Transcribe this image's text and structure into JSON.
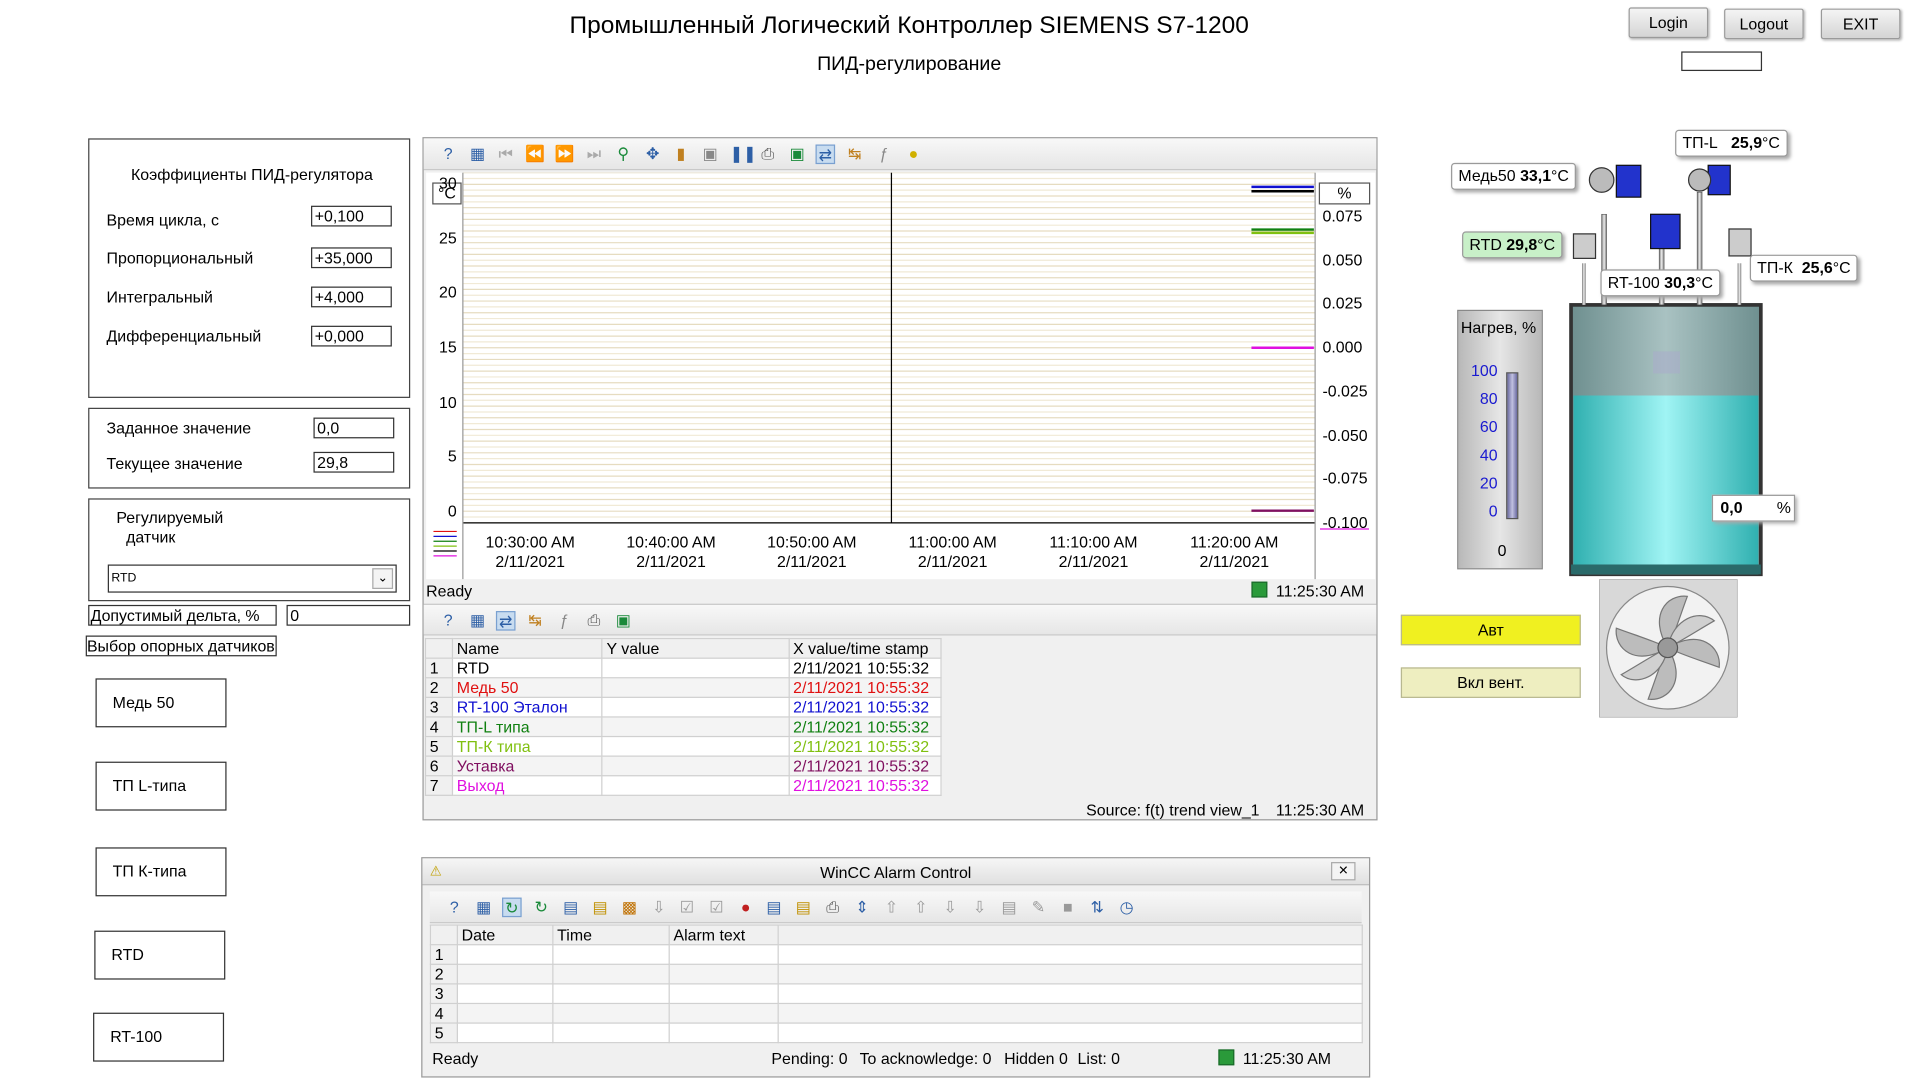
{
  "header": {
    "title": "Промышленный Логический Контроллер SIEMENS S7-1200",
    "subtitle": "ПИД-регулирование",
    "login_label": "Login",
    "logout_label": "Logout",
    "exit_label": "EXIT",
    "user_value": ""
  },
  "pid": {
    "heading": "Коэффициенты ПИД-регулятора",
    "cycle_label": "Время цикла, с",
    "cycle_value": "+0,100",
    "prop_label": "Пропорциональный",
    "prop_value": "+35,000",
    "int_label": "Интегральный",
    "int_value": "+4,000",
    "diff_label": "Дифференциальный",
    "diff_value": "+0,000"
  },
  "setpoint": {
    "set_label": "Заданное значение",
    "set_value": "0,0",
    "cur_label": "Текущее значение",
    "cur_value": "29,8"
  },
  "sensor_select": {
    "label_line1": "Регулируемый",
    "label_line2": "датчик",
    "selected": "RTD"
  },
  "delta": {
    "label": "Допустимый дельта, %",
    "value": "0"
  },
  "reference": {
    "label": "Выбор опорных датчиков",
    "buttons": [
      "Медь 50",
      "ТП L-типа",
      "ТП К-типа",
      "RTD",
      "RT-100"
    ]
  },
  "trend": {
    "left_unit": "°C",
    "right_unit": "%",
    "left_ticks": [
      "30",
      "25",
      "20",
      "15",
      "10",
      "5",
      "0"
    ],
    "right_ticks": [
      "0.075",
      "0.050",
      "0.025",
      "0.000",
      "-0.025",
      "-0.050",
      "-0.075",
      "-0.100"
    ],
    "x_ticks": [
      {
        "time": "10:30:00 AM",
        "date": "2/11/2021"
      },
      {
        "time": "10:40:00 AM",
        "date": "2/11/2021"
      },
      {
        "time": "10:50:00 AM",
        "date": "2/11/2021"
      },
      {
        "time": "11:00:00 AM",
        "date": "2/11/2021"
      },
      {
        "time": "11:10:00 AM",
        "date": "2/11/2021"
      },
      {
        "time": "11:20:00 AM",
        "date": "2/11/2021"
      }
    ],
    "status": "Ready",
    "status_time": "11:25:30 AM"
  },
  "values_table": {
    "headers": [
      "Name",
      "Y value",
      "X value/time stamp"
    ],
    "rows": [
      {
        "idx": "1",
        "name": "RTD",
        "y": "",
        "x": "2/11/2021 10:55:32",
        "color": "#000000"
      },
      {
        "idx": "2",
        "name": "Медь 50",
        "y": "",
        "x": "2/11/2021 10:55:32",
        "color": "#e01010"
      },
      {
        "idx": "3",
        "name": "RT-100 Эталон",
        "y": "",
        "x": "2/11/2021 10:55:32",
        "color": "#1010d0"
      },
      {
        "idx": "4",
        "name": "ТП-L типа",
        "y": "",
        "x": "2/11/2021 10:55:32",
        "color": "#108010"
      },
      {
        "idx": "5",
        "name": "ТП-К типа",
        "y": "",
        "x": "2/11/2021 10:55:32",
        "color": "#80c010"
      },
      {
        "idx": "6",
        "name": "Уставка",
        "y": "",
        "x": "2/11/2021 10:55:32",
        "color": "#801060"
      },
      {
        "idx": "7",
        "name": "Выход",
        "y": "",
        "x": "2/11/2021 10:55:32",
        "color": "#e010e0"
      }
    ],
    "source": "Source: f(t) trend view_1",
    "source_time": "11:25:30 AM"
  },
  "alarm": {
    "title": "WinCC Alarm Control",
    "headers": [
      "Date",
      "Time",
      "Alarm text"
    ],
    "rows": [
      "1",
      "2",
      "3",
      "4",
      "5"
    ],
    "status": "Ready",
    "pending": "Pending: 0",
    "to_ack": "To acknowledge: 0",
    "hidden": "Hidden 0",
    "list": "List: 0",
    "time": "11:25:30 AM"
  },
  "plant": {
    "med50_label": "Медь50",
    "med50_value": "33,1",
    "tpl_label": "ТП-L",
    "tpl_value": "25,9",
    "rtd_label": "RTD",
    "rtd_value": "29,8",
    "rt100_label": "RT-100",
    "rt100_value": "30,3",
    "tpk_label": "ТП-К",
    "tpk_value": "25,6",
    "unit": "°C",
    "heat_label": "Нагрев, %",
    "heat_ticks": [
      "100",
      "80",
      "60",
      "40",
      "20",
      "0"
    ],
    "heat_value": "0",
    "output_value": "0,0",
    "output_unit": "%",
    "auto_label": "Авт",
    "fan_label": "Вкл вент."
  },
  "colors": {
    "auto_button": "#f0f020",
    "fan_button": "#eeeec0",
    "tank": "#5fd8d8"
  }
}
